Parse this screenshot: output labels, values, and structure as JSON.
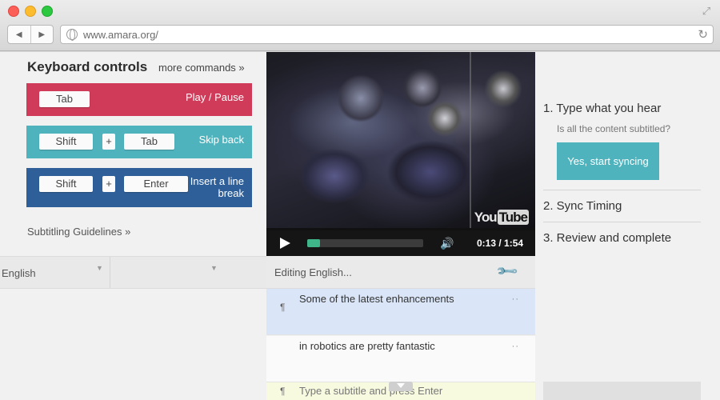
{
  "browser": {
    "url": "www.amara.org/"
  },
  "keyboard": {
    "title": "Keyboard controls",
    "more_commands": "more commands »",
    "shortcuts": [
      {
        "keys": [
          "Tab"
        ],
        "action": "Play / Pause",
        "color": "#cf3b58"
      },
      {
        "keys": [
          "Shift",
          "+",
          "Tab"
        ],
        "action": "Skip back",
        "color": "#4fb3bd"
      },
      {
        "keys": [
          "Shift",
          "+",
          "Enter"
        ],
        "action": "Insert a line break",
        "color": "#2e5f98"
      }
    ],
    "guidelines": "Subtitling Guidelines »"
  },
  "language": {
    "selected": "English"
  },
  "video": {
    "logo_you": "You",
    "logo_tube": "Tube",
    "time": "0:13 / 1:54",
    "progress_fraction": 0.113,
    "accent": "#3fb58a"
  },
  "editor": {
    "title": "Editing English...",
    "subtitles": [
      {
        "text": "Some of the latest enhancements",
        "active": true
      },
      {
        "text": "in robotics are pretty fantastic",
        "active": false
      }
    ],
    "input_placeholder": "Type a subtitle and press Enter"
  },
  "steps": {
    "step1": "1. Type what you hear",
    "question": "Is all the content subtitled?",
    "sync_button": "Yes, start syncing",
    "step2": "2. Sync Timing",
    "step3": "3. Review and complete"
  }
}
